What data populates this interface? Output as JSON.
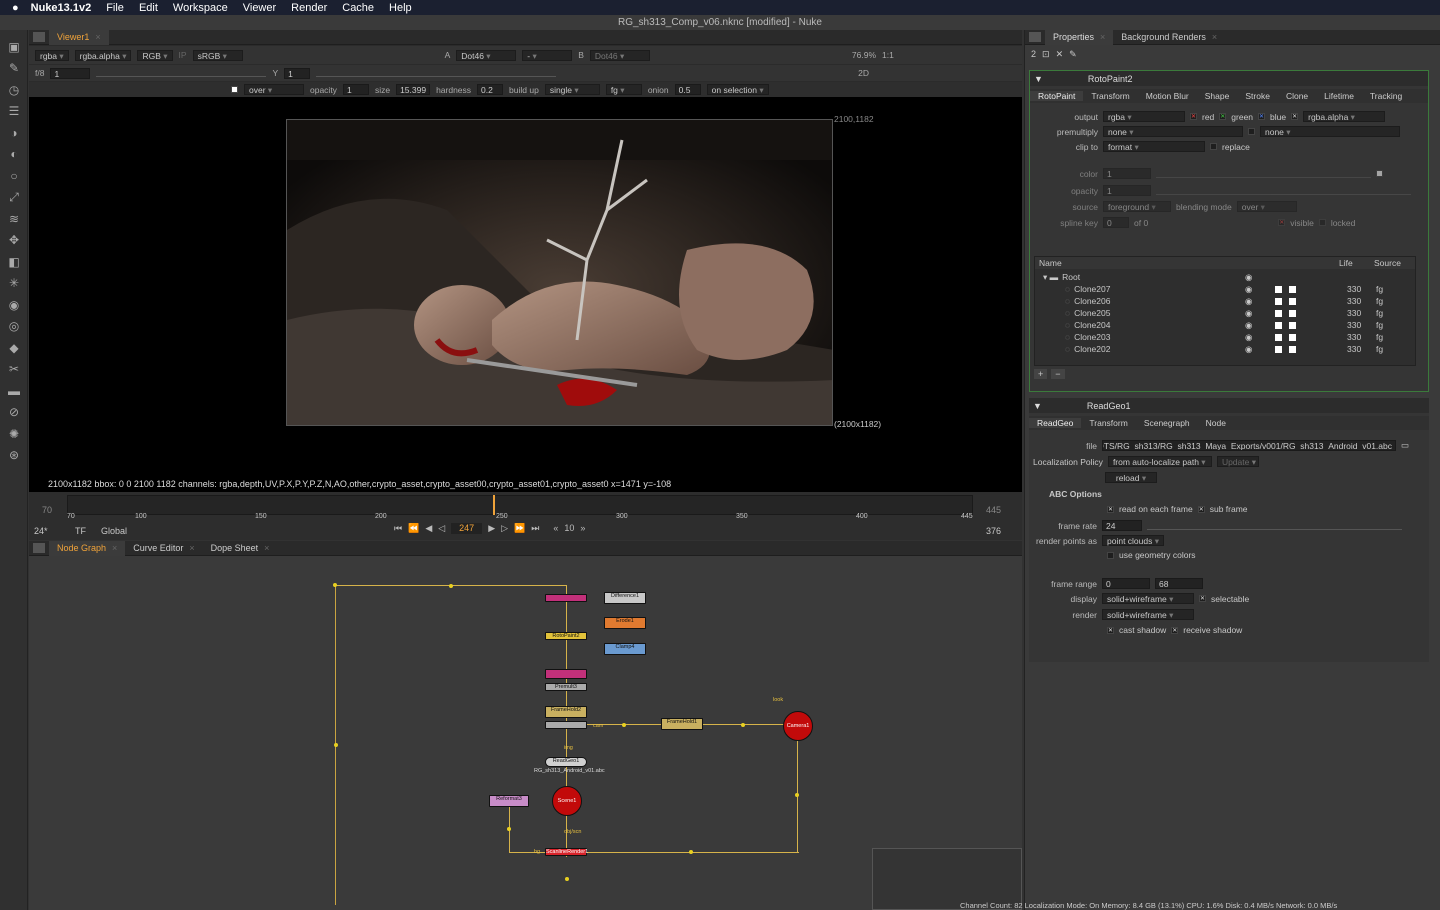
{
  "menubar": {
    "app": "Nuke13.1v2",
    "items": [
      "File",
      "Edit",
      "Workspace",
      "Viewer",
      "Render",
      "Cache",
      "Help"
    ]
  },
  "window": {
    "title": "RG_sh313_Comp_v06.nknc [modified] - Nuke"
  },
  "viewer": {
    "tab": "Viewer1",
    "row1": {
      "channels": "rgba",
      "alpha": "rgba.alpha",
      "colorspace": "RGB",
      "ip": "IP",
      "lut": "sRGB",
      "a_label": "A",
      "a_input": "Dot46",
      "dash": "-",
      "b_label": "B",
      "b_input": "Dot46",
      "zoom": "76.9%",
      "ratio": "1:1"
    },
    "row2": {
      "fstop": "f/8",
      "gain": "1",
      "y_label": "Y",
      "gamma": "1",
      "mode": "2D"
    },
    "row3": {
      "blend": "over",
      "opacity_label": "opacity",
      "opacity": "1",
      "size_label": "size",
      "size": "15.399",
      "hardness_label": "hardness",
      "hardness": "0.2",
      "buildup_label": "build up",
      "stroke": "single",
      "target": "fg",
      "onion_label": "onion",
      "onion": "0.5",
      "selection": "on selection"
    },
    "corner_tr": "2100,1182",
    "corner_br": "(2100x1182)",
    "status": "2100x1182  bbox: 0 0 2100 1182 channels: rgba,depth,UV,P.X,P.Y,P.Z,N,AO,other,crypto_asset,crypto_asset00,crypto_asset01,crypto_asset0  x=1471 y=-108"
  },
  "timeline": {
    "start": "70",
    "end": "445",
    "current": "247",
    "ticks": [
      "70",
      "100",
      "150",
      "200",
      "250",
      "300",
      "350",
      "400",
      "445"
    ],
    "fps": "24*",
    "tf": "TF",
    "scope": "Global",
    "step": "10",
    "last": "376"
  },
  "nodegraph": {
    "tabs": [
      "Node Graph",
      "Curve Editor",
      "Dope Sheet"
    ],
    "nodes": {
      "difference": "Difference1",
      "erode": "Erode1",
      "clamp": "Clamp4",
      "roto": "RotoPaint2",
      "framehold2": "FrameHold2",
      "framehold1": "FrameHold1",
      "readgeo": "ReadGeo1",
      "readgeo_file": "RG_sh313_Android_v01.abc",
      "reformat": "Reformat3",
      "scene": "Scene1",
      "camera": "Camera1",
      "scanline": "ScanlineRender1",
      "premult": "Premult3",
      "look": "look",
      "cam": "cam",
      "img": "img",
      "obj": "obj/scn",
      "bg": "bg"
    }
  },
  "props": {
    "tabs": [
      "Properties",
      "Background Renders"
    ],
    "count": "2",
    "roto": {
      "name": "RotoPaint2",
      "tabs": [
        "RotoPaint",
        "Transform",
        "Motion Blur",
        "Shape",
        "Stroke",
        "Clone",
        "Lifetime",
        "Tracking"
      ],
      "output_label": "output",
      "output": "rgba",
      "red": "red",
      "green": "green",
      "blue": "blue",
      "alpha": "rgba.alpha",
      "premult_label": "premultiply",
      "premult": "none",
      "premult2": "none",
      "clip_label": "clip to",
      "clip": "format",
      "replace": "replace",
      "color_label": "color",
      "color": "1",
      "opacity_label": "opacity",
      "opacity": "1",
      "source_label": "source",
      "source": "foreground",
      "blend_label": "blending mode",
      "blend": "over",
      "spline_label": "spline key",
      "spline": "0",
      "of": "of 0",
      "visible": "visible",
      "locked": "locked",
      "tree_headers": {
        "name": "Name",
        "life": "Life",
        "source": "Source"
      },
      "root": "Root",
      "items": [
        {
          "name": "Clone207",
          "life": "330",
          "src": "fg"
        },
        {
          "name": "Clone206",
          "life": "330",
          "src": "fg"
        },
        {
          "name": "Clone205",
          "life": "330",
          "src": "fg"
        },
        {
          "name": "Clone204",
          "life": "330",
          "src": "fg"
        },
        {
          "name": "Clone203",
          "life": "330",
          "src": "fg"
        },
        {
          "name": "Clone202",
          "life": "330",
          "src": "fg"
        }
      ]
    },
    "readgeo": {
      "name": "ReadGeo1",
      "tabs": [
        "ReadGeo",
        "Transform",
        "Scenegraph",
        "Node"
      ],
      "file_label": "file",
      "file": "DTS/RG_sh313/RG_sh313_Maya_Exports/v001/RG_sh313_Android_v01.abc",
      "loc_label": "Localization Policy",
      "loc": "from auto-localize path",
      "update": "Update",
      "reload": "reload",
      "abc_label": "ABC Options",
      "read_each": "read on each frame",
      "sub_frame": "sub frame",
      "fr_label": "frame rate",
      "fr": "24",
      "rp_label": "render points as",
      "rp": "point clouds",
      "geo_colors": "use geometry colors",
      "range_label": "frame range",
      "range_start": "0",
      "range_end": "68",
      "display_label": "display",
      "display": "solid+wireframe",
      "selectable": "selectable",
      "render_label": "render",
      "render": "solid+wireframe",
      "cast": "cast shadow",
      "receive": "receive shadow"
    }
  },
  "statusbar": "Channel Count: 82  Localization Mode: On  Memory: 8.4 GB (13.1%)  CPU: 1.6%  Disk: 0.4 MB/s  Network: 0.0 MB/s"
}
